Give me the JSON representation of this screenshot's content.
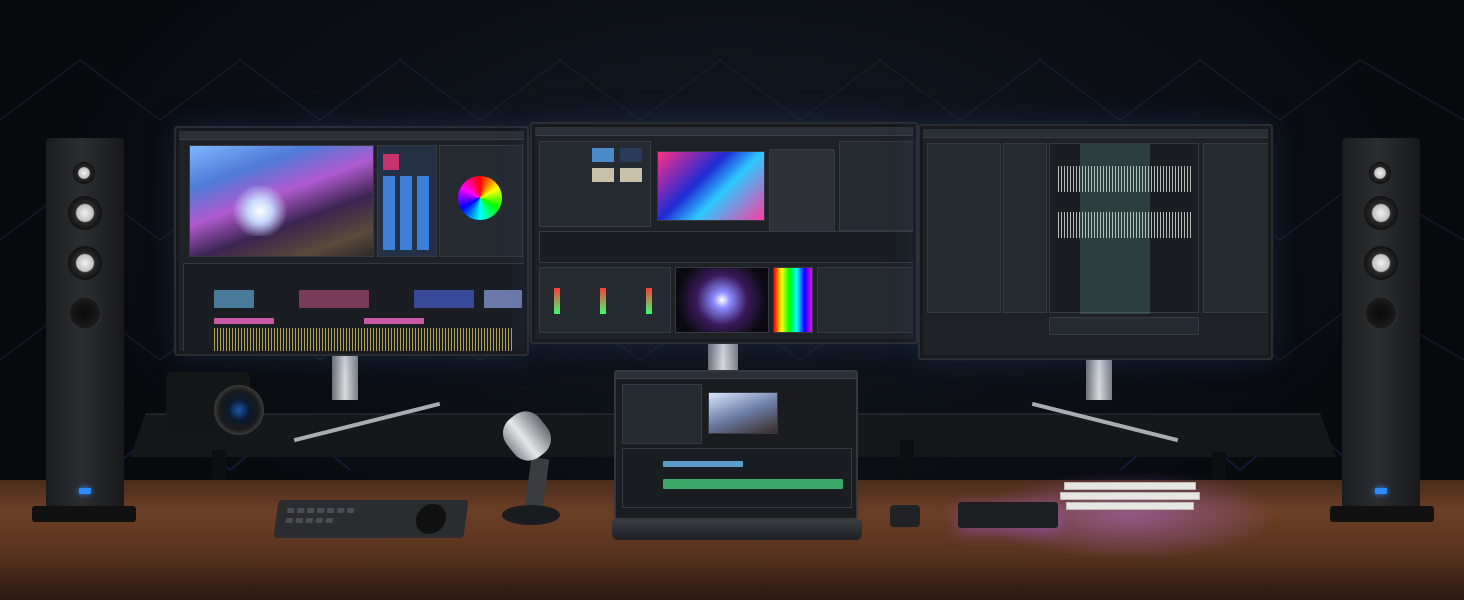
{
  "scene": {
    "description_alt": "",
    "colors": {
      "wall": "#07090d",
      "accent_blue": "#2d8cff",
      "desk_wood": "#6b3f26",
      "ambient_purple": "#c878ff"
    }
  },
  "objects": {
    "monitors": [
      {
        "name": "left-monitor",
        "content": "video-editor-ui"
      },
      {
        "name": "center-monitor",
        "content": "color-grading-ui"
      },
      {
        "name": "right-monitor",
        "content": "audio-editor-ui"
      }
    ],
    "laptop": {
      "content": "video-editor-ui"
    },
    "speakers": [
      {
        "name": "left-speaker"
      },
      {
        "name": "right-speaker"
      }
    ],
    "props": [
      "camera",
      "microphone",
      "control-keyboard",
      "usb-hub",
      "books",
      "monitor-stands"
    ]
  }
}
